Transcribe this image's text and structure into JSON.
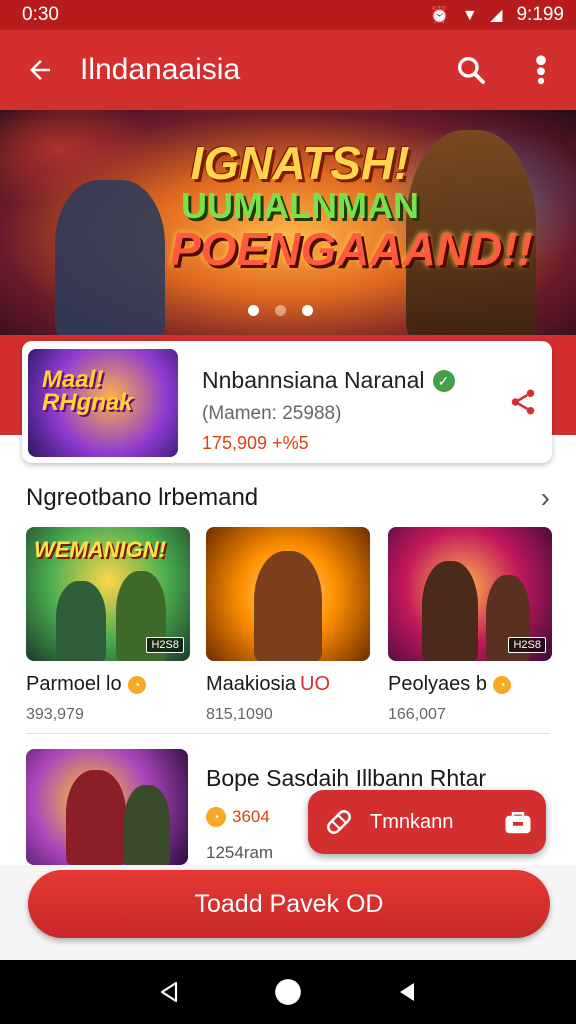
{
  "status_bar": {
    "left_time": "0:30",
    "right_time": "9:199"
  },
  "app_bar": {
    "title": "Ilndanaaisia"
  },
  "banner": {
    "line1": "IGNATSH!",
    "line2": "UUMALNMAN",
    "line3": "POENGAAAND!!",
    "active_dot": 1
  },
  "featured": {
    "thumb_text": "Maal! RHgnak",
    "name": "Nnbannsiana Naranal",
    "meta": "(Mamen: 25988)",
    "count": "175,909 +%5"
  },
  "section": {
    "title": "Ngreotbano lrbemand",
    "items": [
      {
        "thumb_text": "WEMANIGN!",
        "tag": "H2S8",
        "name": "Parmoel lo",
        "count": "393,979"
      },
      {
        "thumb_text": "",
        "tag": "",
        "name": "Maakiosia",
        "name_accent": "UO",
        "count": "815,1090"
      },
      {
        "thumb_text": "",
        "tag": "H2S8",
        "name": "Peolyaes b",
        "count": "166,007"
      }
    ]
  },
  "list_item": {
    "name": "Bope Sasdaih Illbann Rhtar",
    "rating": "3604",
    "subtitle": "1254ram"
  },
  "fab": {
    "label": "Tmnkann"
  },
  "cta": {
    "label": "Toadd Pavek OD"
  },
  "colors": {
    "primary": "#d32f2f",
    "primary_dark": "#b71c1c",
    "accent_text": "#d84315"
  }
}
